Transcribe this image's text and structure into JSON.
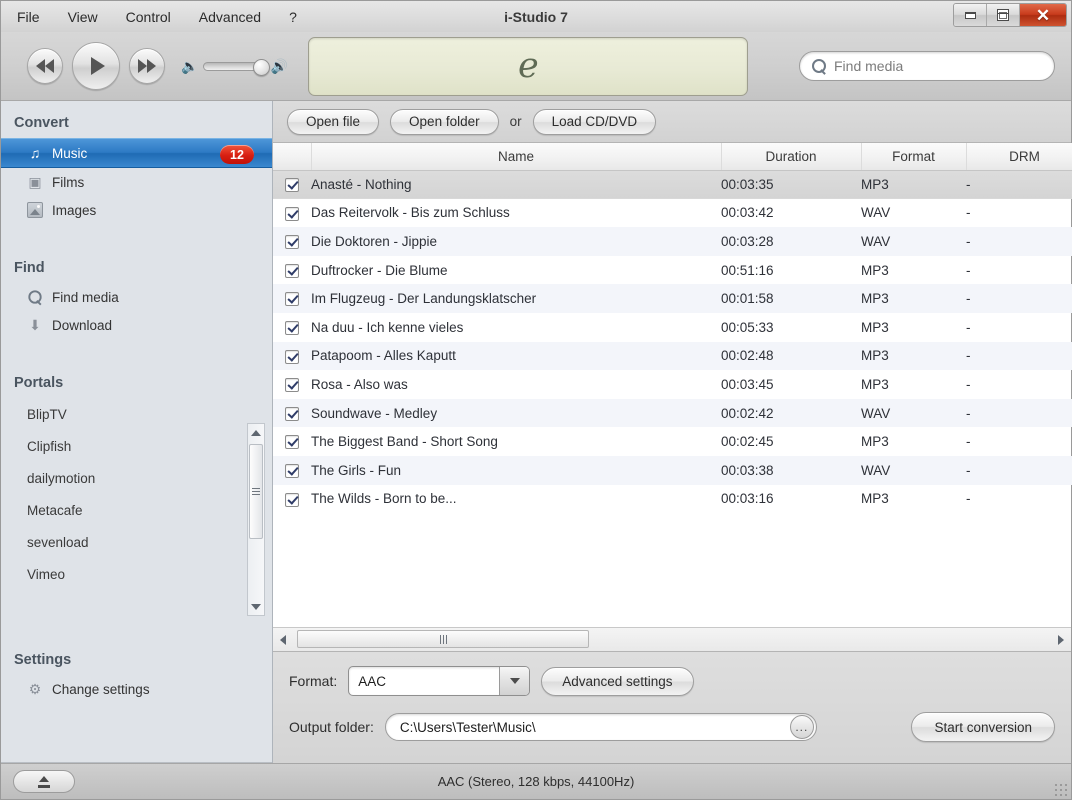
{
  "window": {
    "title": "i-Studio 7",
    "controls": [
      {
        "name": "minimize",
        "icon": "minimize-icon"
      },
      {
        "name": "maximize",
        "icon": "maximize-icon"
      },
      {
        "name": "close",
        "icon": "close-icon"
      }
    ],
    "close_color": "#c8391b"
  },
  "menu": [
    "File",
    "View",
    "Control",
    "Advanced",
    "?"
  ],
  "player": {
    "prev_icon": "rewind-icon",
    "play_icon": "play-icon",
    "next_icon": "fast-forward-icon",
    "volume_low_icon": "volume-low-icon",
    "volume_high_icon": "volume-high-icon",
    "volume_value": 88,
    "display_logo": "e",
    "display_color": "#e8ead5"
  },
  "search": {
    "placeholder": "Find media",
    "icon": "search-icon",
    "value": ""
  },
  "sidebar": {
    "sections": [
      {
        "title": "Convert",
        "items": [
          {
            "label": "Music",
            "icon": "music-note-icon",
            "selected": true,
            "badge": "12"
          },
          {
            "label": "Films",
            "icon": "film-icon",
            "selected": false,
            "badge": ""
          },
          {
            "label": "Images",
            "icon": "image-icon",
            "selected": false,
            "badge": ""
          }
        ]
      },
      {
        "title": "Find",
        "items": [
          {
            "label": "Find media",
            "icon": "search-icon",
            "selected": false,
            "badge": ""
          },
          {
            "label": "Download",
            "icon": "download-arrow-icon",
            "selected": false,
            "badge": ""
          }
        ]
      }
    ],
    "portals_title": "Portals",
    "portals": [
      "BlipTV",
      "Clipfish",
      "dailymotion",
      "Metacafe",
      "sevenload",
      "Vimeo"
    ],
    "settings_title": "Settings",
    "settings_item": {
      "label": "Change settings",
      "icon": "gear-icon"
    },
    "selected_color": "#2d7ac4",
    "badge_color": "#d81f12"
  },
  "toolbar": {
    "open_file_label": "Open file",
    "open_folder_label": "Open folder",
    "or_label": "or",
    "load_cd_label": "Load CD/DVD"
  },
  "table": {
    "columns": [
      "",
      "Name",
      "Duration",
      "Format",
      "DRM"
    ],
    "rows": [
      {
        "checked": true,
        "name": "Anasté - Nothing",
        "duration": "00:03:35",
        "format": "MP3",
        "drm": "-",
        "selected": true
      },
      {
        "checked": true,
        "name": "Das Reitervolk - Bis zum Schluss",
        "duration": "00:03:42",
        "format": "WAV",
        "drm": "-",
        "selected": false
      },
      {
        "checked": true,
        "name": "Die Doktoren - Jippie",
        "duration": "00:03:28",
        "format": "WAV",
        "drm": "-",
        "selected": false
      },
      {
        "checked": true,
        "name": "Duftrocker - Die Blume",
        "duration": "00:51:16",
        "format": "MP3",
        "drm": "-",
        "selected": false
      },
      {
        "checked": true,
        "name": "Im Flugzeug - Der Landungsklatscher",
        "duration": "00:01:58",
        "format": "MP3",
        "drm": "-",
        "selected": false
      },
      {
        "checked": true,
        "name": "Na duu - Ich kenne vieles",
        "duration": "00:05:33",
        "format": "MP3",
        "drm": "-",
        "selected": false
      },
      {
        "checked": true,
        "name": "Patapoom - Alles Kaputt",
        "duration": "00:02:48",
        "format": "MP3",
        "drm": "-",
        "selected": false
      },
      {
        "checked": true,
        "name": "Rosa - Also was",
        "duration": "00:03:45",
        "format": "MP3",
        "drm": "-",
        "selected": false
      },
      {
        "checked": true,
        "name": "Soundwave - Medley",
        "duration": "00:02:42",
        "format": "WAV",
        "drm": "-",
        "selected": false
      },
      {
        "checked": true,
        "name": "The Biggest Band - Short Song",
        "duration": "00:02:45",
        "format": "MP3",
        "drm": "-",
        "selected": false
      },
      {
        "checked": true,
        "name": "The Girls - Fun",
        "duration": "00:03:38",
        "format": "WAV",
        "drm": "-",
        "selected": false
      },
      {
        "checked": true,
        "name": "The Wilds - Born to be...",
        "duration": "00:03:16",
        "format": "MP3",
        "drm": "-",
        "selected": false
      }
    ]
  },
  "options": {
    "format_label": "Format:",
    "format_value": "AAC",
    "advanced_label": "Advanced settings",
    "output_label": "Output folder:",
    "output_value": "C:\\Users\\Tester\\Music\\",
    "browse_label": "...",
    "start_label": "Start conversion"
  },
  "statusbar": {
    "eject_icon": "eject-icon",
    "text": "AAC (Stereo, 128 kbps, 44100Hz)"
  }
}
